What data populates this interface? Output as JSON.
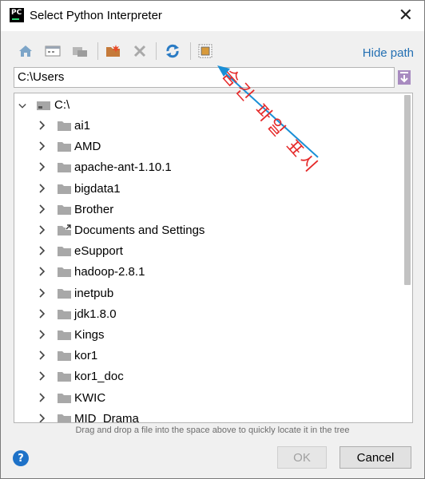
{
  "window": {
    "title": "Select Python Interpreter",
    "app_icon_label": "PC"
  },
  "toolbar": {
    "hide_path_label": "Hide path"
  },
  "path": {
    "value": "C:\\Users"
  },
  "tree": {
    "root": "C:\\",
    "items": [
      {
        "label": "ai1",
        "icon": "folder-icon"
      },
      {
        "label": "AMD",
        "icon": "folder-icon"
      },
      {
        "label": "apache-ant-1.10.1",
        "icon": "folder-icon"
      },
      {
        "label": "bigdata1",
        "icon": "folder-icon"
      },
      {
        "label": "Brother",
        "icon": "folder-icon"
      },
      {
        "label": "Documents and Settings",
        "icon": "folder-shortcut-icon"
      },
      {
        "label": "eSupport",
        "icon": "folder-icon"
      },
      {
        "label": "hadoop-2.8.1",
        "icon": "folder-icon"
      },
      {
        "label": "inetpub",
        "icon": "folder-icon"
      },
      {
        "label": "jdk1.8.0",
        "icon": "folder-icon"
      },
      {
        "label": "Kings",
        "icon": "folder-icon"
      },
      {
        "label": "kor1",
        "icon": "folder-icon"
      },
      {
        "label": "kor1_doc",
        "icon": "folder-icon"
      },
      {
        "label": "KWIC",
        "icon": "folder-icon"
      },
      {
        "label": "MID_Drama",
        "icon": "folder-icon"
      }
    ]
  },
  "hint": "Drag and drop a file into the space above to quickly locate it in the tree",
  "buttons": {
    "ok": "OK",
    "cancel": "Cancel",
    "help": "?"
  },
  "annotation": {
    "text": "숨긴 파일 표시"
  },
  "colors": {
    "accent": "#2470b3",
    "annotation": "#e52a2a",
    "arrow": "#1a8fd6"
  }
}
